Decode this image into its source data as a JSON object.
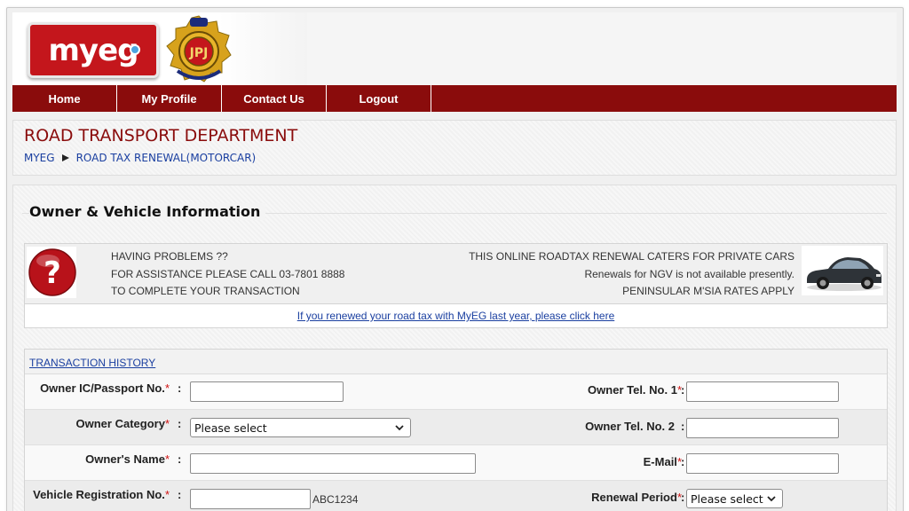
{
  "brand": {
    "logo_text": "myeg",
    "seal_text": "JPJ"
  },
  "nav": {
    "items": [
      "Home",
      "My Profile",
      "Contact Us",
      "Logout"
    ]
  },
  "department": {
    "title": "ROAD TRANSPORT DEPARTMENT",
    "breadcrumb": [
      "MYEG",
      "ROAD TAX RENEWAL(MOTORCAR)"
    ]
  },
  "section": {
    "title": "Owner & Vehicle Information"
  },
  "help": {
    "lines": [
      "HAVING PROBLEMS ??",
      "FOR ASSISTANCE PLEASE CALL 03-7801 8888",
      "TO COMPLETE YOUR TRANSACTION"
    ],
    "notes": [
      "THIS ONLINE ROADTAX RENEWAL CATERS FOR PRIVATE CARS",
      "Renewals for NGV is not available presently.",
      "PENINSULAR M'SIA RATES APPLY"
    ],
    "link": "If you renewed your road tax with MyEG last year, please click here"
  },
  "form": {
    "transaction_history": "TRANSACTION HISTORY",
    "owner_ic_label": "Owner IC/Passport No.",
    "owner_ic_value": "",
    "owner_category_label": "Owner Category",
    "owner_category_value": "Please select",
    "owner_name_label": "Owner's Name",
    "owner_name_value": "",
    "vehicle_reg_label": "Vehicle Registration No.",
    "vehicle_reg_value": "",
    "vehicle_reg_hint": "ABC1234",
    "tel1_label": "Owner Tel. No. 1",
    "tel1_value": "",
    "tel2_label": "Owner Tel. No. 2",
    "tel2_value": "",
    "email_label": "E-Mail",
    "email_value": "",
    "renewal_period_label": "Renewal Period",
    "renewal_period_value": "Please select",
    "required_mark": "*",
    "colon": ":"
  },
  "colors": {
    "nav_bg": "#8a0c0c",
    "dept_title": "#8a0c0c",
    "link": "#1a3fa0",
    "required": "#d01010"
  }
}
